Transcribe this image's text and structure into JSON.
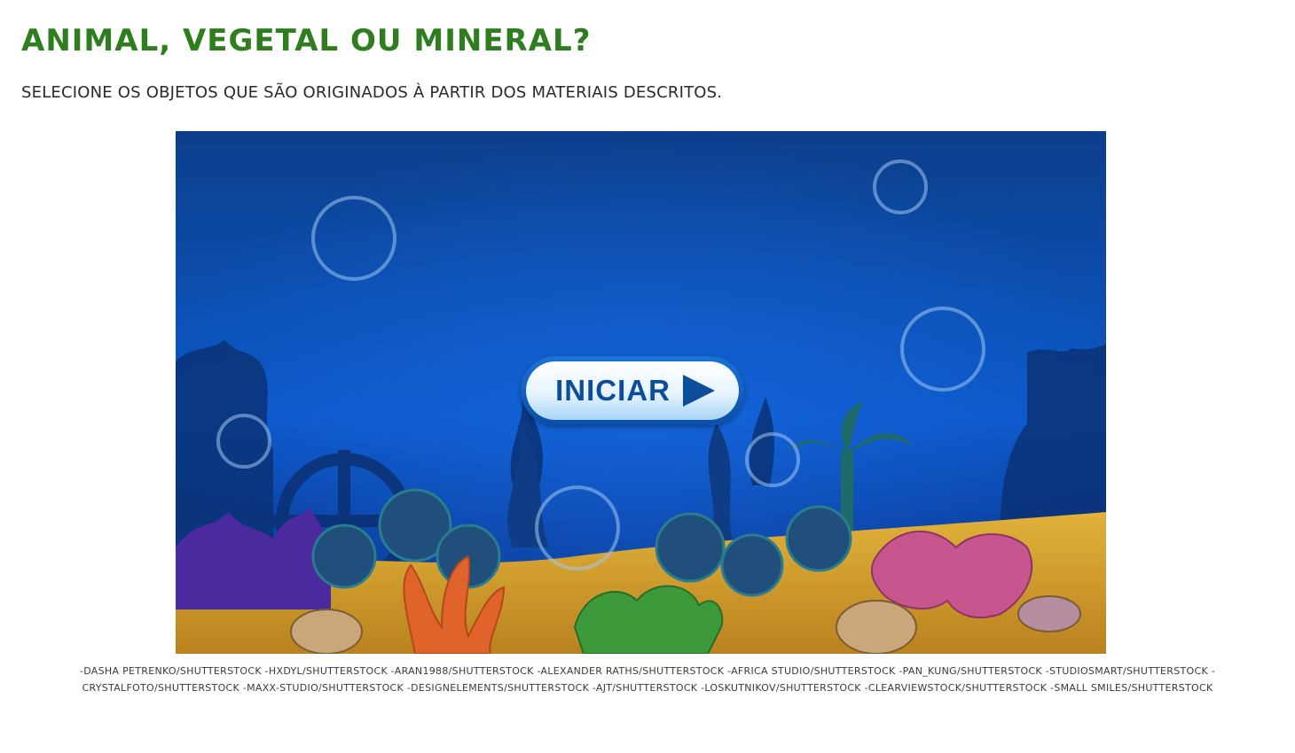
{
  "page": {
    "title": "ANIMAL, VEGETAL OU MINERAL?",
    "subtitle": "SELECIONE OS OBJETOS QUE SÃO ORIGINADOS À PARTIR DOS MATERIAIS DESCRITOS."
  },
  "game": {
    "start_button_label": "INICIAR",
    "start_button_icon": "play-icon",
    "scene": "underwater-reef-illustration"
  },
  "credits": {
    "line1": "-DASHA PETRENKO/SHUTTERSTOCK -HXDYL/SHUTTERSTOCK -ARAN1988/SHUTTERSTOCK -ALEXANDER RATHS/SHUTTERSTOCK -AFRICA STUDIO/SHUTTERSTOCK -PAN_KUNG/SHUTTERSTOCK -STUDIOSMART/SHUTTERSTOCK -",
    "line2": "CRYSTALFOTO/SHUTTERSTOCK -MAXX-STUDIO/SHUTTERSTOCK -DESIGNELEMENTS/SHUTTERSTOCK -AJT/SHUTTERSTOCK -LOSKUTNIKOV/SHUTTERSTOCK -CLEARVIEWSTOCK/SHUTTERSTOCK -SMALL SMILES/SHUTTERSTOCK"
  },
  "colors": {
    "title_green": "#2e7d1e",
    "water_blue": "#0c57c8",
    "button_text_blue": "#0c4d9c"
  }
}
